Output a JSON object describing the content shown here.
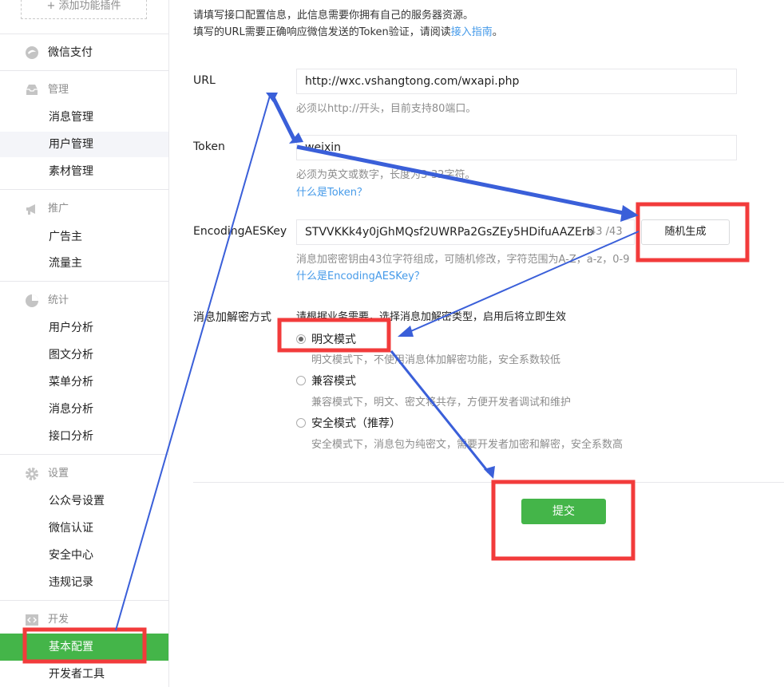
{
  "sidebar": {
    "add_plugin": "+ 添加功能插件",
    "pay": {
      "label": "微信支付"
    },
    "manage": {
      "label": "管理",
      "items": [
        "消息管理",
        "用户管理",
        "素材管理"
      ]
    },
    "promote": {
      "label": "推广",
      "items": [
        "广告主",
        "流量主"
      ]
    },
    "stats": {
      "label": "统计",
      "items": [
        "用户分析",
        "图文分析",
        "菜单分析",
        "消息分析",
        "接口分析"
      ]
    },
    "settings": {
      "label": "设置",
      "items": [
        "公众号设置",
        "微信认证",
        "安全中心",
        "违规记录"
      ]
    },
    "dev": {
      "label": "开发",
      "items": [
        "基本配置",
        "开发者工具"
      ],
      "active_item": "基本配置"
    }
  },
  "main": {
    "intro_line1": "请填写接口配置信息，此信息需要你拥有自己的服务器资源。",
    "intro_line2_prefix": "填写的URL需要正确响应微信发送的Token验证，请阅读",
    "intro_line2_link": "接入指南",
    "intro_line2_suffix": "。",
    "url": {
      "label": "URL",
      "value": "http://wxc.vshangtong.com/wxapi.php",
      "hint": "必须以http://开头，目前支持80端口。"
    },
    "token": {
      "label": "Token",
      "value": "weixin",
      "hint": "必须为英文或数字，长度为3-32字符。",
      "link": "什么是Token？"
    },
    "aes": {
      "label": "EncodingAESKey",
      "value": "STVVKKk4y0jGhMQsf2UWRPa2GsZEy5HDifuAAZErb",
      "count": "43 /43",
      "button": "随机生成",
      "hint": "消息加密密钥由43位字符组成，可随机修改，字符范围为A-Z，a-z，0-9",
      "link": "什么是EncodingAESKey？"
    },
    "mode": {
      "label": "消息加解密方式",
      "hint": "请根据业务需要，选择消息加解密类型，启用后将立即生效",
      "options": [
        {
          "label": "明文模式",
          "desc": "明文模式下，不使用消息体加解密功能，安全系数较低",
          "checked": true
        },
        {
          "label": "兼容模式",
          "desc": "兼容模式下，明文、密文将共存，方便开发者调试和维护",
          "checked": false
        },
        {
          "label": "安全模式（推荐）",
          "desc": "安全模式下，消息包为纯密文，需要开发者加密和解密，安全系数高",
          "checked": false
        }
      ]
    },
    "submit": "提交"
  },
  "colors": {
    "accent_green": "#44b549",
    "link_blue": "#459ae9",
    "annotation_red": "#f23b3b",
    "annotation_arrow": "#3a5fd9"
  }
}
